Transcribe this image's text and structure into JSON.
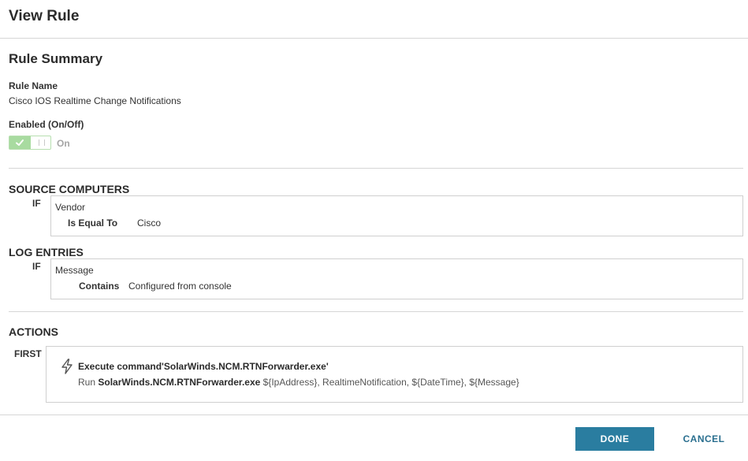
{
  "header": {
    "title": "View Rule"
  },
  "summary": {
    "title": "Rule Summary",
    "rule_name_label": "Rule Name",
    "rule_name_value": "Cisco IOS Realtime Change Notifications",
    "enabled_label": "Enabled (On/Off)",
    "enabled_state": "On"
  },
  "source_computers": {
    "title": "SOURCE COMPUTERS",
    "keyword": "IF",
    "field": "Vendor",
    "operator": "Is Equal To",
    "value": "Cisco"
  },
  "log_entries": {
    "title": "LOG ENTRIES",
    "keyword": "IF",
    "field": "Message",
    "operator": "Contains",
    "value": "Configured from console"
  },
  "actions": {
    "title": "ACTIONS",
    "keyword": "FIRST",
    "icon": "lightning-icon",
    "action_title": "Execute command'SolarWinds.NCM.RTNForwarder.exe'",
    "run_prefix": "Run",
    "run_program": "SolarWinds.NCM.RTNForwarder.exe",
    "run_args": "${IpAddress}, RealtimeNotification, ${DateTime}, ${Message}"
  },
  "footer": {
    "done_label": "DONE",
    "cancel_label": "CANCEL"
  },
  "colors": {
    "primary_button": "#2a7da0",
    "toggle_on": "#a8dba0"
  }
}
